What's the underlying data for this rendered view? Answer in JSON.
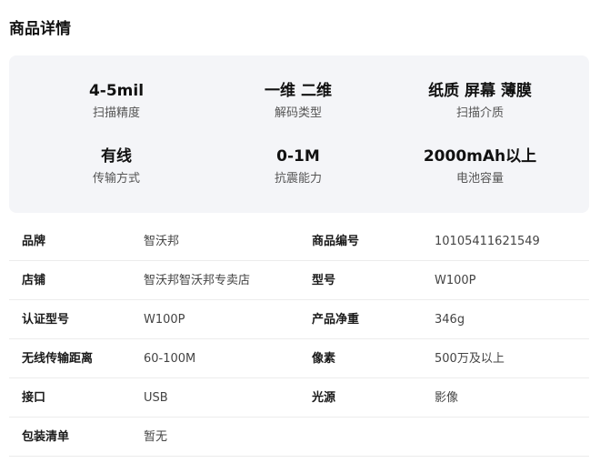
{
  "page": {
    "title": "商品详情"
  },
  "highlights": [
    {
      "value": "4-5mil",
      "label": "扫描精度"
    },
    {
      "value": "一维 二维",
      "label": "解码类型"
    },
    {
      "value": "纸质 屏幕 薄膜",
      "label": "扫描介质"
    },
    {
      "value": "有线",
      "label": "传输方式"
    },
    {
      "value": "0-1M",
      "label": "抗震能力"
    },
    {
      "value": "2000mAh以上",
      "label": "电池容量"
    }
  ],
  "specs": [
    {
      "k1": "品牌",
      "v1": "智沃邦",
      "k2": "商品编号",
      "v2": "10105411621549"
    },
    {
      "k1": "店铺",
      "v1": "智沃邦智沃邦专卖店",
      "k2": "型号",
      "v2": "W100P"
    },
    {
      "k1": "认证型号",
      "v1": "W100P",
      "k2": "产品净重",
      "v2": "346g"
    },
    {
      "k1": "无线传输距离",
      "v1": "60-100M",
      "k2": "像素",
      "v2": "500万及以上"
    },
    {
      "k1": "接口",
      "v1": "USB",
      "k2": "光源",
      "v2": "影像"
    },
    {
      "k1": "包装清单",
      "v1": "暂无",
      "k2": "",
      "v2": ""
    }
  ]
}
